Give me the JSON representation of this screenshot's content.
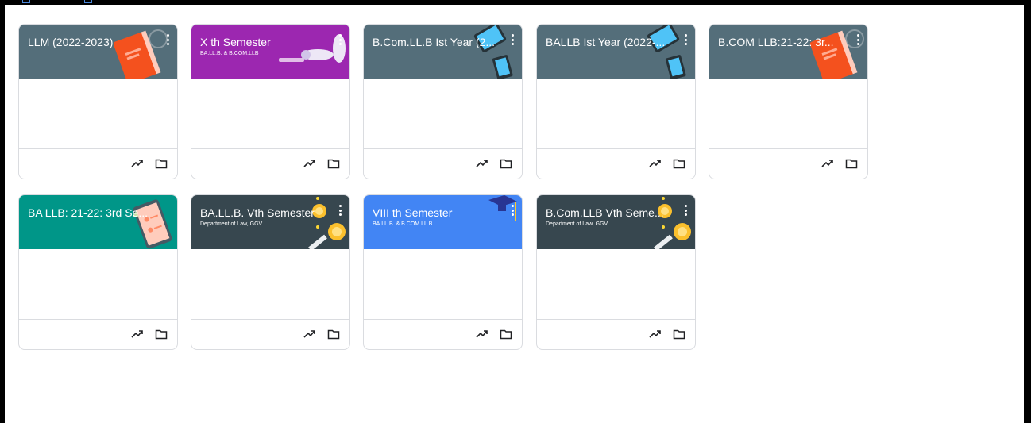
{
  "cards": [
    {
      "title": "LLM (2022-2023)",
      "subtitle": "",
      "color": "#546e7a",
      "theme": "book"
    },
    {
      "title": "X th Semester",
      "subtitle": "BA.LL.B. & B.COM.LLB",
      "color": "#9c27b0",
      "theme": "bowling"
    },
    {
      "title": "B.Com.LL.B Ist Year (2...",
      "subtitle": "",
      "color": "#546e7a",
      "theme": "tablet"
    },
    {
      "title": "BALLB Ist Year (2022-...",
      "subtitle": "",
      "color": "#546e7a",
      "theme": "tablet"
    },
    {
      "title": "B.COM LLB:21-22: 3r...",
      "subtitle": "",
      "color": "#546e7a",
      "theme": "book"
    },
    {
      "title": "BA LLB: 21-22: 3rd Se...",
      "subtitle": "",
      "color": "#009688",
      "theme": "phone"
    },
    {
      "title": "BA.LL.B. Vth Semester",
      "subtitle": "Department of Law, GGV",
      "color": "#37474f",
      "theme": "coin"
    },
    {
      "title": "VIII th Semester",
      "subtitle": "BA.LL.B. & B.COM.LL.B.",
      "color": "#4285f4",
      "theme": "cap"
    },
    {
      "title": "B.Com.LLB Vth Seme...",
      "subtitle": "Department of Law, GGV",
      "color": "#37474f",
      "theme": "coin"
    }
  ],
  "icons": {
    "menu": "more-vert-icon",
    "trend": "trending-up-icon",
    "folder": "folder-icon"
  }
}
